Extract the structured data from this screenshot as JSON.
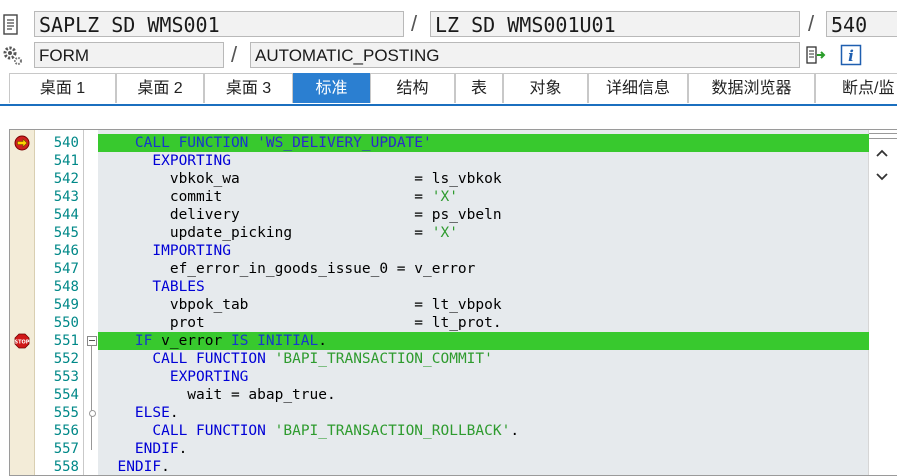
{
  "header": {
    "program": "SAPLZ_SD_WMS001",
    "include": "LZ_SD_WMS001U01",
    "line_no": "540",
    "event_type": "FORM",
    "event_name": "AUTOMATIC_POSTING",
    "slash": "/"
  },
  "tabs": [
    {
      "label": "桌面 1"
    },
    {
      "label": "桌面 2"
    },
    {
      "label": "桌面 3"
    },
    {
      "label": "标准"
    },
    {
      "label": "结构"
    },
    {
      "label": "表"
    },
    {
      "label": "对象"
    },
    {
      "label": "详细信息"
    },
    {
      "label": "数据浏览器"
    },
    {
      "label": "断点/监"
    }
  ],
  "active_tab": "标准",
  "code_lines": [
    {
      "no": "540",
      "text": "    CALL FUNCTION 'WS_DELIVERY_UPDATE'",
      "highlight": true,
      "breakpoint": "current-arrow"
    },
    {
      "no": "541",
      "text": "      EXPORTING"
    },
    {
      "no": "542",
      "text": "        vbkok_wa                    = ls_vbkok"
    },
    {
      "no": "543",
      "text": "        commit                      = 'X'"
    },
    {
      "no": "544",
      "text": "        delivery                    = ps_vbeln"
    },
    {
      "no": "545",
      "text": "        update_picking              = 'X'"
    },
    {
      "no": "546",
      "text": "      IMPORTING"
    },
    {
      "no": "547",
      "text": "        ef_error_in_goods_issue_0 = v_error"
    },
    {
      "no": "548",
      "text": "      TABLES"
    },
    {
      "no": "549",
      "text": "        vbpok_tab                   = lt_vbpok"
    },
    {
      "no": "550",
      "text": "        prot                        = lt_prot."
    },
    {
      "no": "551",
      "text": "    IF v_error IS INITIAL.",
      "highlight": true,
      "breakpoint": "stop"
    },
    {
      "no": "552",
      "text": "      CALL FUNCTION 'BAPI_TRANSACTION_COMMIT'"
    },
    {
      "no": "553",
      "text": "        EXPORTING"
    },
    {
      "no": "554",
      "text": "          wait = abap_true."
    },
    {
      "no": "555",
      "text": "    ELSE."
    },
    {
      "no": "556",
      "text": "      CALL FUNCTION 'BAPI_TRANSACTION_ROLLBACK'."
    },
    {
      "no": "557",
      "text": "    ENDIF."
    },
    {
      "no": "558",
      "text": "  ENDIF."
    }
  ],
  "colors": {
    "highlight": "#38c92e",
    "keyword": "#0000d6",
    "string": "#2e9b2e",
    "line_number": "#008888",
    "tab_active": "#2b7fd1"
  },
  "icons": {
    "doc": "document-icon",
    "gear": "gear-icon",
    "execute": "display-object-icon",
    "info": "info-icon",
    "scroll_up": "chevron-up-icon",
    "scroll_down": "chevron-down-icon",
    "bp_current": "current-statement-arrow-icon",
    "bp_stop": "stop-breakpoint-icon",
    "fold": "collapse-block-icon"
  }
}
